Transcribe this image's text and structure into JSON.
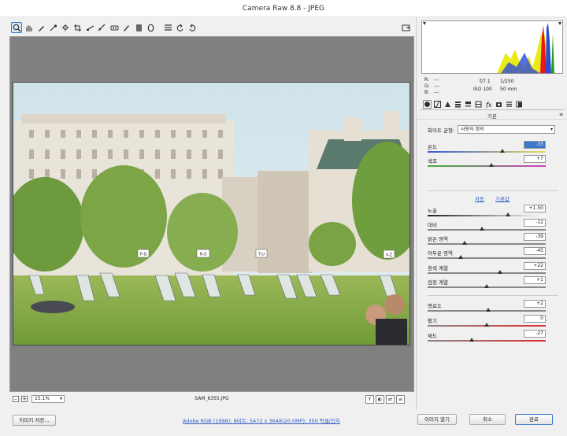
{
  "window": {
    "title": "Camera Raw 8.8  -  JPEG"
  },
  "toolbar": {
    "tools": [
      "zoom-tool",
      "hand-tool",
      "white-balance-tool",
      "color-sampler-tool",
      "targeted-adjustment-tool",
      "crop-tool",
      "straighten-tool",
      "spot-removal-tool",
      "red-eye-tool",
      "adjustment-brush-tool",
      "graduated-filter-tool",
      "radial-filter-tool",
      "preferences-tool",
      "rotate-left-tool",
      "rotate-right-tool"
    ],
    "fullscreen": "fullscreen-toggle"
  },
  "status": {
    "zoom": "15.1%",
    "filename": "SAM_6355.JPG"
  },
  "photo_signs": [
    "P-Q",
    "R-S",
    "T-U",
    "V-Z"
  ],
  "histogram": {
    "r_label": "R:",
    "g_label": "G:",
    "b_label": "B:",
    "r": "---",
    "g": "---",
    "b": "---",
    "aperture": "f/7.1",
    "shutter": "1/250",
    "iso": "ISO 100",
    "focal": "50 mm"
  },
  "panel": {
    "section_title": "기본",
    "wb_label": "화이트 균형:",
    "wb_value": "사용자 정의",
    "auto_link": "자동",
    "default_link": "기본값",
    "sliders": [
      {
        "label": "온도",
        "value": "-33",
        "pos": 0.63,
        "grad": [
          "#3a5ad8",
          "#e8e060"
        ],
        "selected": true
      },
      {
        "label": "색조",
        "value": "+7",
        "pos": 0.54,
        "grad": [
          "#40b040",
          "#d040c0"
        ],
        "selected": false
      },
      {
        "label": "노출",
        "value": "+1.50",
        "pos": 0.68,
        "grad": [
          "#222",
          "#fff"
        ],
        "selected": false
      },
      {
        "label": "대비",
        "value": "-12",
        "pos": 0.46,
        "grad": [
          "#888",
          "#888"
        ],
        "selected": false
      },
      {
        "label": "밝은 영역",
        "value": "-39",
        "pos": 0.31,
        "grad": [
          "#888",
          "#888"
        ],
        "selected": false
      },
      {
        "label": "어두운 영역",
        "value": "-45",
        "pos": 0.28,
        "grad": [
          "#888",
          "#888"
        ],
        "selected": false
      },
      {
        "label": "흰색 계열",
        "value": "+22",
        "pos": 0.61,
        "grad": [
          "#888",
          "#888"
        ],
        "selected": false
      },
      {
        "label": "검정 계열",
        "value": "+1",
        "pos": 0.5,
        "grad": [
          "#888",
          "#888"
        ],
        "selected": false
      },
      {
        "label": "명료도",
        "value": "+2",
        "pos": 0.51,
        "grad": [
          "#888",
          "#888"
        ],
        "selected": false
      },
      {
        "label": "활기",
        "value": "0",
        "pos": 0.5,
        "grad": [
          "#888",
          "#e03030"
        ],
        "selected": false
      },
      {
        "label": "채도",
        "value": "-27",
        "pos": 0.37,
        "grad": [
          "#888",
          "#e03030"
        ],
        "selected": false
      }
    ]
  },
  "bottom": {
    "save_label": "이미지 저장...",
    "info_link": "Adobe RGB (1998); 8비트; 5472 x 3648(20.0MP); 300 픽셀/인치",
    "open_label": "이미지 열기",
    "cancel_label": "취소",
    "done_label": "완료"
  },
  "colors": {
    "accent": "#3a78c8",
    "link": "#2a5bc4"
  }
}
